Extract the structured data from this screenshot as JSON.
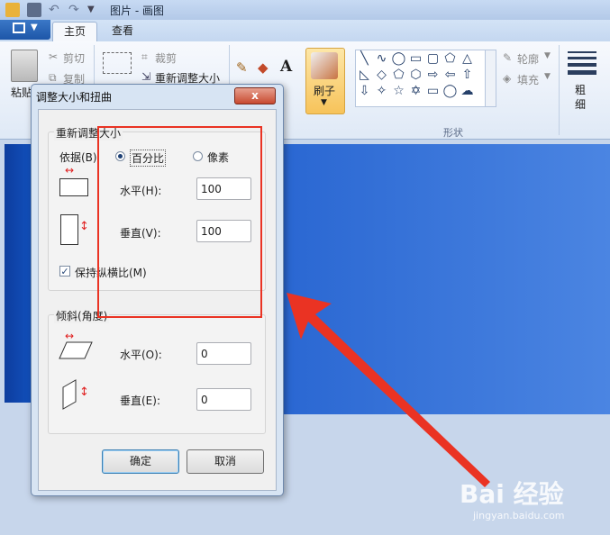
{
  "window": {
    "title": "图片 - 画图"
  },
  "ribbon_tabs": [
    {
      "label": "主页"
    },
    {
      "label": "查看"
    }
  ],
  "clipboard": {
    "paste": "粘贴",
    "cut": "剪切",
    "copy": "复制"
  },
  "image_group": {
    "crop": "裁剪",
    "resize": "重新调整大小"
  },
  "brushes": {
    "label": "刷子"
  },
  "shapes": {
    "group_label": "形状",
    "outline": "轮廓",
    "fill": "填充"
  },
  "size": {
    "label": "粗细"
  },
  "dialog": {
    "title": "调整大小和扭曲",
    "close": "x",
    "resize_group": {
      "title": "重新调整大小",
      "by_label": "依据(B)",
      "percent_label": "百分比",
      "pixels_label": "像素",
      "selected": "percent",
      "horizontal_label": "水平(H):",
      "horizontal_value": "100",
      "vertical_label": "垂直(V):",
      "vertical_value": "100",
      "keep_ratio_label": "保持纵横比(M)",
      "keep_ratio_checked": true
    },
    "skew_group": {
      "title": "倾斜(角度)",
      "horizontal_label": "水平(O):",
      "horizontal_value": "0",
      "vertical_label": "垂直(E):",
      "vertical_value": "0"
    },
    "ok": "确定",
    "cancel": "取消"
  },
  "watermark": {
    "brand": "Bai 经验",
    "url": "jingyan.baidu.com"
  },
  "colors": {
    "highlight": "#ea3323",
    "accent": "#1d56a8"
  }
}
